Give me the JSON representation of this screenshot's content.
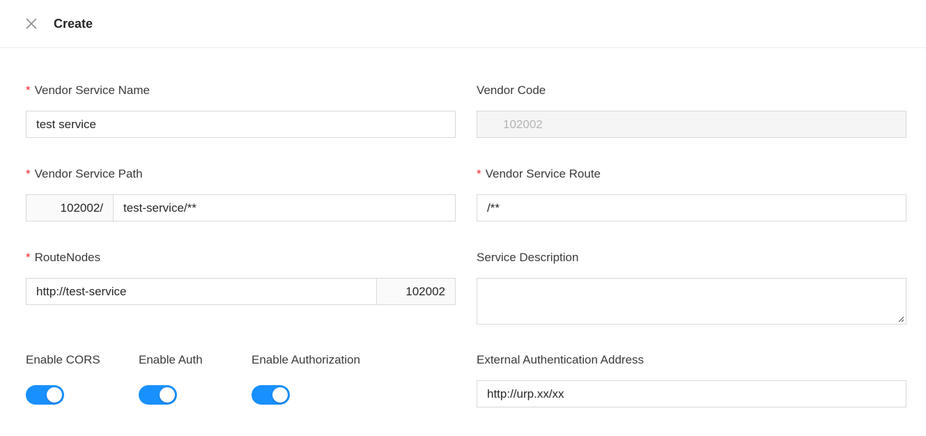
{
  "header": {
    "title": "Create"
  },
  "form": {
    "vendor_service_name": {
      "label": "Vendor Service Name",
      "required_mark": "*",
      "value": "test service"
    },
    "vendor_code": {
      "label": "Vendor Code",
      "value": "102002"
    },
    "vendor_service_path": {
      "label": "Vendor Service Path",
      "required_mark": "*",
      "prefix": "102002/",
      "value": "test-service/**"
    },
    "vendor_service_route": {
      "label": "Vendor Service Route",
      "required_mark": "*",
      "value": "/**"
    },
    "route_nodes": {
      "label": "RouteNodes",
      "required_mark": "*",
      "value": "http://test-service",
      "suffix": "102002"
    },
    "service_description": {
      "label": "Service Description",
      "value": ""
    },
    "enable_cors": {
      "label": "Enable CORS",
      "checked": true
    },
    "enable_auth": {
      "label": "Enable Auth",
      "checked": true
    },
    "enable_authorization": {
      "label": "Enable Authorization",
      "checked": true
    },
    "external_auth_address": {
      "label": "External Authentication Address",
      "value": "http://urp.xx/xx"
    }
  },
  "colors": {
    "primary": "#1890ff",
    "required": "#f5222d",
    "border": "#d9d9d9"
  },
  "icons": {
    "close": "close-icon",
    "resize": "resize-grip-icon"
  }
}
